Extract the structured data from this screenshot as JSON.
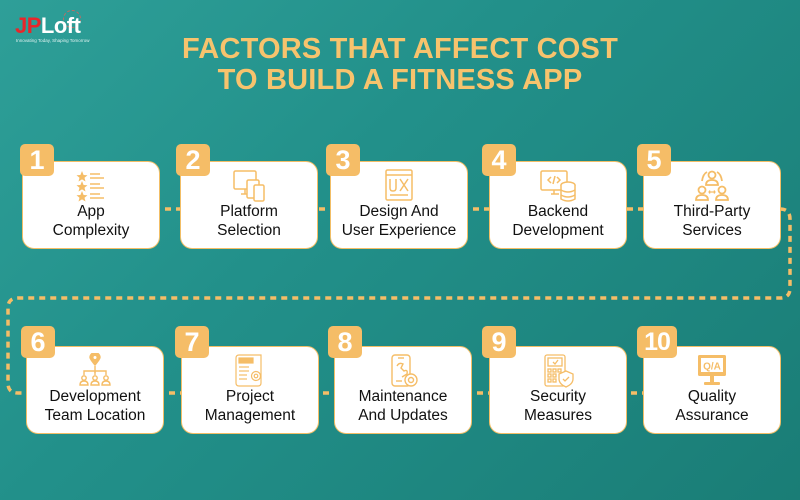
{
  "brand": {
    "logo_prefix": "JP",
    "logo_suffix": "Loft",
    "tagline": "Innovating Today, Shaping Tomorrow",
    "colors": {
      "red": "#e8262a",
      "accent": "#f5bd67",
      "title": "#f7c36d",
      "background": "#22908a"
    }
  },
  "title": {
    "line1": "FACTORS THAT AFFECT COST",
    "line2": "TO BUILD A FITNESS APP"
  },
  "factors": [
    {
      "number": "1",
      "line1": "App",
      "line2": "Complexity",
      "icon": "star-list-icon"
    },
    {
      "number": "2",
      "line1": "Platform",
      "line2": "Selection",
      "icon": "multi-device-icon"
    },
    {
      "number": "3",
      "line1": "Design And",
      "line2": "User Experience",
      "icon": "ux-window-icon"
    },
    {
      "number": "4",
      "line1": "Backend",
      "line2": "Development",
      "icon": "code-database-icon"
    },
    {
      "number": "5",
      "line1": "Third-Party",
      "line2": "Services",
      "icon": "people-exchange-icon"
    },
    {
      "number": "6",
      "line1": "Development",
      "line2": "Team Location",
      "icon": "team-location-icon"
    },
    {
      "number": "7",
      "line1": "Project",
      "line2": "Management",
      "icon": "project-document-icon"
    },
    {
      "number": "8",
      "line1": "Maintenance",
      "line2": "And Updates",
      "icon": "phone-wrench-icon"
    },
    {
      "number": "9",
      "line1": "Security",
      "line2": "Measures",
      "icon": "keypad-shield-icon"
    },
    {
      "number": "10",
      "line1": "Quality",
      "line2": "Assurance",
      "icon": "qa-monitor-icon"
    }
  ]
}
